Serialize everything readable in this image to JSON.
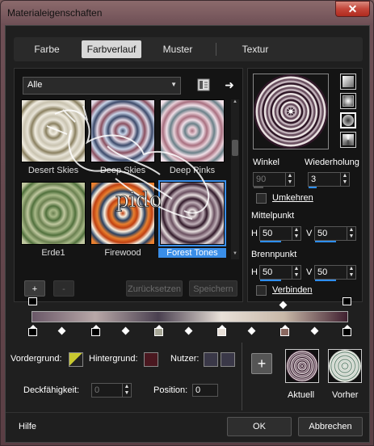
{
  "window": {
    "title": "Materialeigenschaften",
    "close_label": "✕"
  },
  "tabs": [
    {
      "label": "Farbe"
    },
    {
      "label": "Farbverlauf"
    },
    {
      "label": "Muster"
    },
    {
      "label": "Textur"
    }
  ],
  "library": {
    "dropdown_value": "Alle",
    "watermark_text": "pido",
    "thumbnails": [
      {
        "label": "Desert Skies",
        "colors": [
          "#c9c3b0",
          "#f0ece0",
          "#8a8060",
          "#e8e4d8"
        ]
      },
      {
        "label": "Deep Skies",
        "colors": [
          "#3c4a6a",
          "#c8d4e8",
          "#8a5060",
          "#e0d8e4"
        ]
      },
      {
        "label": "Deep Pinks",
        "colors": [
          "#a87080",
          "#e8d0d8",
          "#6a8088",
          "#f0e0e8"
        ]
      },
      {
        "label": "Erde1",
        "colors": [
          "#6a8050",
          "#a8b888",
          "#50703c",
          "#c0c8a0"
        ]
      },
      {
        "label": "Firewood",
        "colors": [
          "#c04010",
          "#f8f0e0",
          "#2a4060",
          "#e88030"
        ]
      },
      {
        "label": "Forest Tones",
        "colors": [
          "#301828",
          "#e8e0e0",
          "#6a5060",
          "#c0b0b8"
        ]
      }
    ],
    "selected_index": 5,
    "add_label": "+",
    "remove_label": "-",
    "reset_label": "Zurücksetzen",
    "save_label": "Speichern"
  },
  "settings": {
    "winkel_label": "Winkel",
    "winkel_value": "90",
    "wiederholung_label": "Wiederholung",
    "wiederholung_value": "3",
    "umkehren_label": "Umkehren",
    "mittelpunkt_label": "Mittelpunkt",
    "mittel_h_label": "H",
    "mittel_h_value": "50",
    "mittel_v_label": "V",
    "mittel_v_value": "50",
    "brennpunkt_label": "Brennpunkt",
    "brenn_h_label": "H",
    "brenn_h_value": "50",
    "brenn_v_label": "V",
    "brenn_v_value": "50",
    "verbinden_label": "Verbinden"
  },
  "gradient_bar": {
    "colors": [
      "#6a5868",
      "#b8a8a8",
      "#4a4050",
      "#e8e0d8",
      "#c8b8a8",
      "#402030"
    ],
    "stop_colors": [
      "#000000",
      "#000000",
      "#a8a898",
      "#e8e0d8",
      "#8a6860",
      "#000000"
    ]
  },
  "bottom": {
    "vordergrund_label": "Vordergrund:",
    "hintergrund_label": "Hintergrund:",
    "nutzer_label": "Nutzer:",
    "deckfahigkeit_label": "Deckfähigkeit:",
    "deckfahigkeit_value": "0",
    "position_label": "Position:",
    "position_value": "0",
    "aktuell_label": "Aktuell",
    "vorher_label": "Vorher",
    "add_label": "+",
    "foreground_color": "#c8c830",
    "background_color": "#4a1820",
    "user_color": "#3a3848"
  },
  "footer": {
    "help_label": "Hilfe",
    "ok_label": "OK",
    "cancel_label": "Abbrechen"
  }
}
